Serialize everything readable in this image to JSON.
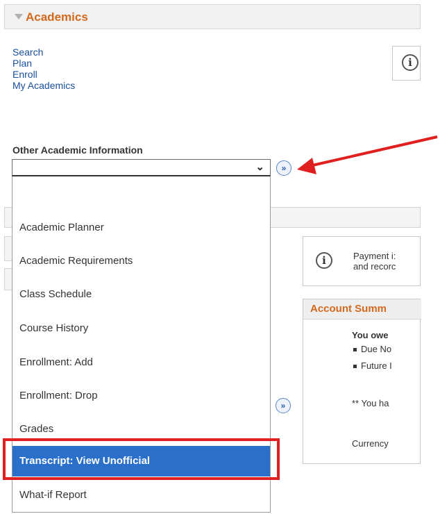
{
  "header": {
    "title": "Academics"
  },
  "nav_links": [
    "Search",
    "Plan",
    "Enroll",
    "My Academics"
  ],
  "other_info": {
    "label": "Other Academic Information",
    "selected_value": "",
    "go_button": "»",
    "options": [
      "",
      "Academic Planner",
      "Academic Requirements",
      "Class Schedule",
      "Course History",
      "Enrollment: Add",
      "Enrollment: Drop",
      "Grades",
      "Transcript: View Unofficial",
      "What-if Report"
    ],
    "highlighted_option": "Transcript: View Unofficial"
  },
  "payment_notice": {
    "line1": "Payment i:",
    "line2": "and recorc"
  },
  "account_summary": {
    "title": "Account Summ",
    "you_owe": "You owe",
    "items": [
      "Due No",
      "Future I"
    ],
    "note": "** You ha",
    "currency": "Currency"
  },
  "icons": {
    "info": "info-icon",
    "go": "double-chevron-right-icon",
    "arrow": "red-arrow"
  },
  "colors": {
    "accent": "#d2691e",
    "selected": "#2a6fc9",
    "highlight": "#e02020",
    "link": "#1a4f9c"
  }
}
